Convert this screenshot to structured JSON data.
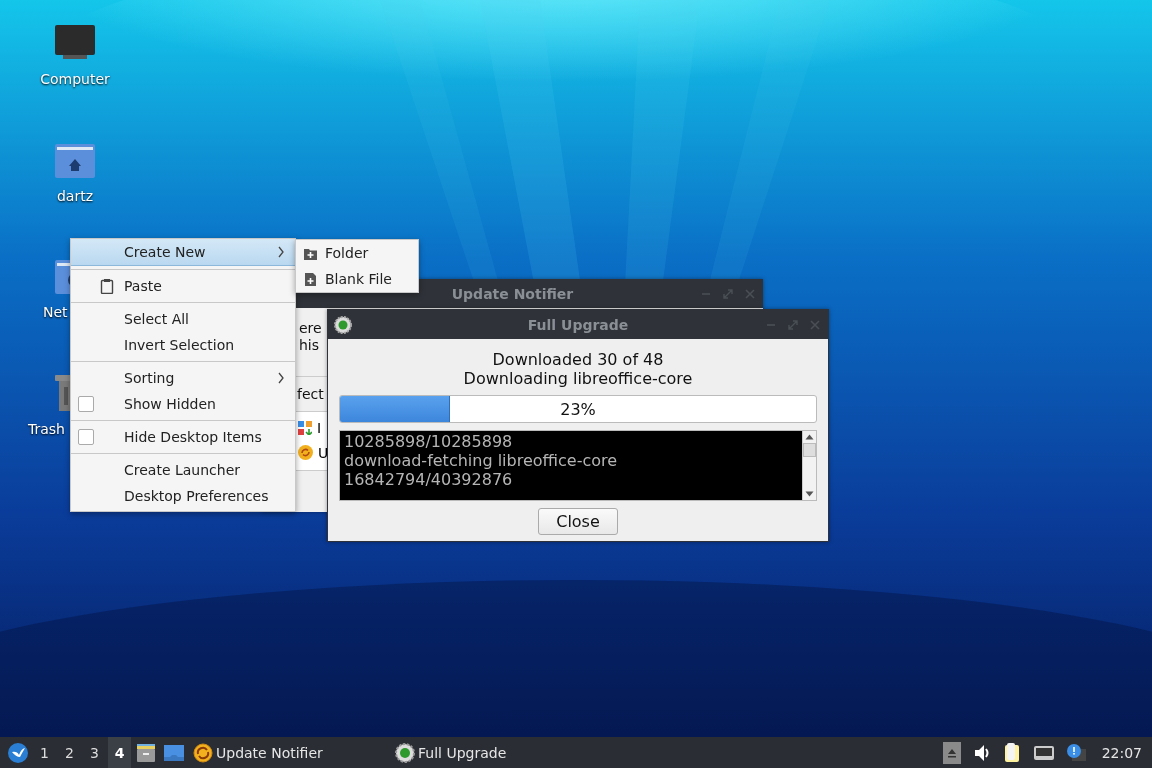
{
  "desktop_icons": [
    {
      "kind": "computer",
      "label": "Computer"
    },
    {
      "kind": "home",
      "label": "dartz"
    },
    {
      "kind": "network",
      "label": "Net"
    },
    {
      "kind": "trash",
      "label": "Trash"
    }
  ],
  "context_menu": {
    "items": [
      {
        "kind": "submenu",
        "label": "Create New",
        "selected": true
      },
      {
        "kind": "separator"
      },
      {
        "kind": "icon",
        "label": "Paste"
      },
      {
        "kind": "separator"
      },
      {
        "kind": "plain",
        "label": "Select All"
      },
      {
        "kind": "plain",
        "label": "Invert Selection"
      },
      {
        "kind": "separator"
      },
      {
        "kind": "submenu",
        "label": "Sorting",
        "selected": false
      },
      {
        "kind": "check",
        "label": "Show Hidden",
        "checked": false
      },
      {
        "kind": "separator"
      },
      {
        "kind": "check",
        "label": "Hide Desktop Items",
        "checked": false
      },
      {
        "kind": "separator"
      },
      {
        "kind": "plain",
        "label": "Create Launcher"
      },
      {
        "kind": "plain",
        "label": "Desktop Preferences"
      }
    ]
  },
  "submenu": {
    "items": [
      {
        "label": "Folder"
      },
      {
        "label": "Blank File"
      }
    ]
  },
  "background_window": {
    "title": "Update Notifier",
    "text_lines": [
      "ere",
      "his"
    ],
    "section_label": "fect",
    "list_items": [
      {
        "kind": "apps",
        "label": "I"
      },
      {
        "kind": "update",
        "label": "U"
      }
    ]
  },
  "dialog": {
    "title": "Full Upgrade",
    "status_lines": [
      "Downloaded 30 of 48",
      "Downloading libreoffice-core"
    ],
    "progress": {
      "level": 0.23,
      "text": "23%"
    },
    "log_lines": [
      "10285898/10285898",
      "download-fetching libreoffice-core",
      "16842794/40392876"
    ],
    "close_button": "Close"
  },
  "taskbar": {
    "workspaces": [
      {
        "label": "1",
        "selected": false
      },
      {
        "label": "2",
        "selected": false
      },
      {
        "label": "3",
        "selected": false
      },
      {
        "label": "4",
        "selected": true
      }
    ],
    "tasks": [
      {
        "kind": "update",
        "label": "Update Notifier"
      },
      {
        "kind": "gear",
        "label": "Full Upgrade"
      }
    ],
    "clock": "22:07"
  }
}
